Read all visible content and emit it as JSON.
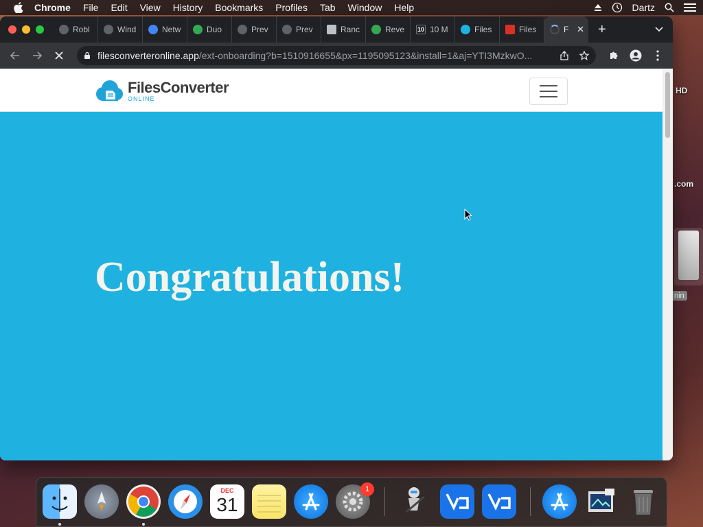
{
  "menubar": {
    "app_name": "Chrome",
    "items": [
      "File",
      "Edit",
      "View",
      "History",
      "Bookmarks",
      "Profiles",
      "Tab",
      "Window",
      "Help"
    ],
    "user": "Dartz"
  },
  "desktop": {
    "labels": [
      "HD",
      ".com",
      "nin"
    ]
  },
  "browser": {
    "tabs": [
      {
        "title": "Robl",
        "color": "#5f6368"
      },
      {
        "title": "Wind",
        "color": "#5f6368"
      },
      {
        "title": "Netw",
        "color": "#4285f4"
      },
      {
        "title": "Duo",
        "color": "#34a853"
      },
      {
        "title": "Prev",
        "color": "#5f6368"
      },
      {
        "title": "Prev",
        "color": "#5f6368"
      },
      {
        "title": "Ranc",
        "color": "#bdc1c6"
      },
      {
        "title": "Reve",
        "color": "#34a853"
      },
      {
        "title": "10 M",
        "color": "#202124"
      },
      {
        "title": "Files",
        "color": "#1fb2e0"
      },
      {
        "title": "Files",
        "color": "#d93025"
      }
    ],
    "active_tab": {
      "title": "F"
    },
    "url_domain": "filesconverteronline.app",
    "url_path": "/ext-onboarding?b=1510916655&px=1195095123&install=1&aj=YTI3MzkwO..."
  },
  "page": {
    "logo_main": "FilesConverter",
    "logo_sub": "ONLINE",
    "headline": "Congratulations!",
    "accent_color": "#1fb2e0"
  },
  "dock": {
    "calendar_month": "DEC",
    "calendar_day": "31",
    "settings_badge": "1",
    "icons": [
      "finder-icon",
      "launchpad-icon",
      "chrome-icon",
      "safari-icon",
      "calendar-icon",
      "notes-icon",
      "app-store-icon",
      "system-preferences-icon",
      "automator-icon",
      "vscode-icon",
      "vscode-icon",
      "app-store-icon",
      "preview-icon",
      "trash-icon"
    ]
  }
}
